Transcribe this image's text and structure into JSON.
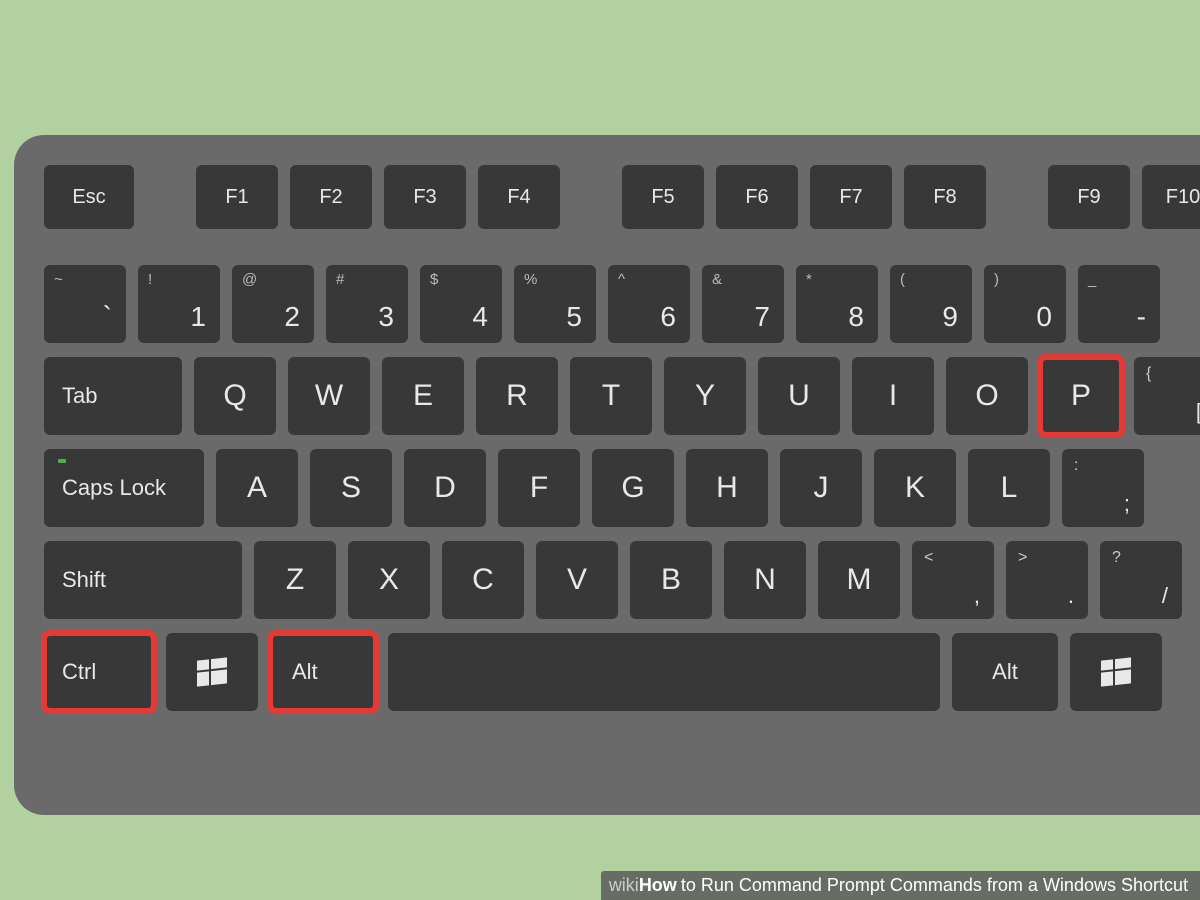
{
  "caption": {
    "brand_wiki": "wiki",
    "brand_how": "How",
    "text": " to Run Command Prompt Commands from a Windows Shortcut"
  },
  "rows": {
    "function": {
      "esc": "Esc",
      "f1": "F1",
      "f2": "F2",
      "f3": "F3",
      "f4": "F4",
      "f5": "F5",
      "f6": "F6",
      "f7": "F7",
      "f8": "F8",
      "f9": "F9",
      "f10": "F10"
    },
    "number": [
      {
        "upper": "~",
        "lower": "`"
      },
      {
        "upper": "!",
        "lower": "1"
      },
      {
        "upper": "@",
        "lower": "2"
      },
      {
        "upper": "#",
        "lower": "3"
      },
      {
        "upper": "$",
        "lower": "4"
      },
      {
        "upper": "%",
        "lower": "5"
      },
      {
        "upper": "^",
        "lower": "6"
      },
      {
        "upper": "&",
        "lower": "7"
      },
      {
        "upper": "*",
        "lower": "8"
      },
      {
        "upper": "(",
        "lower": "9"
      },
      {
        "upper": ")",
        "lower": "0"
      },
      {
        "upper": "_",
        "lower": "-"
      }
    ],
    "qwerty": {
      "tab": "Tab",
      "letters": [
        "Q",
        "W",
        "E",
        "R",
        "T",
        "Y",
        "U",
        "I",
        "O",
        "P"
      ],
      "bracket": {
        "upper": "{",
        "lower": "["
      }
    },
    "asdf": {
      "caps": "Caps Lock",
      "letters": [
        "A",
        "S",
        "D",
        "F",
        "G",
        "H",
        "J",
        "K",
        "L"
      ],
      "semi": {
        "upper": ":",
        "lower": ";"
      }
    },
    "zxcv": {
      "shift": "Shift",
      "letters": [
        "Z",
        "X",
        "C",
        "V",
        "B",
        "N",
        "M"
      ],
      "comma": {
        "upper": "<",
        "lower": ","
      },
      "period": {
        "upper": ">",
        "lower": "."
      },
      "slash": {
        "upper": "?",
        "lower": "/"
      }
    },
    "bottom": {
      "ctrl": "Ctrl",
      "alt": "Alt",
      "alt_r": "Alt"
    }
  },
  "highlighted_keys": [
    "Ctrl",
    "Alt",
    "P"
  ]
}
